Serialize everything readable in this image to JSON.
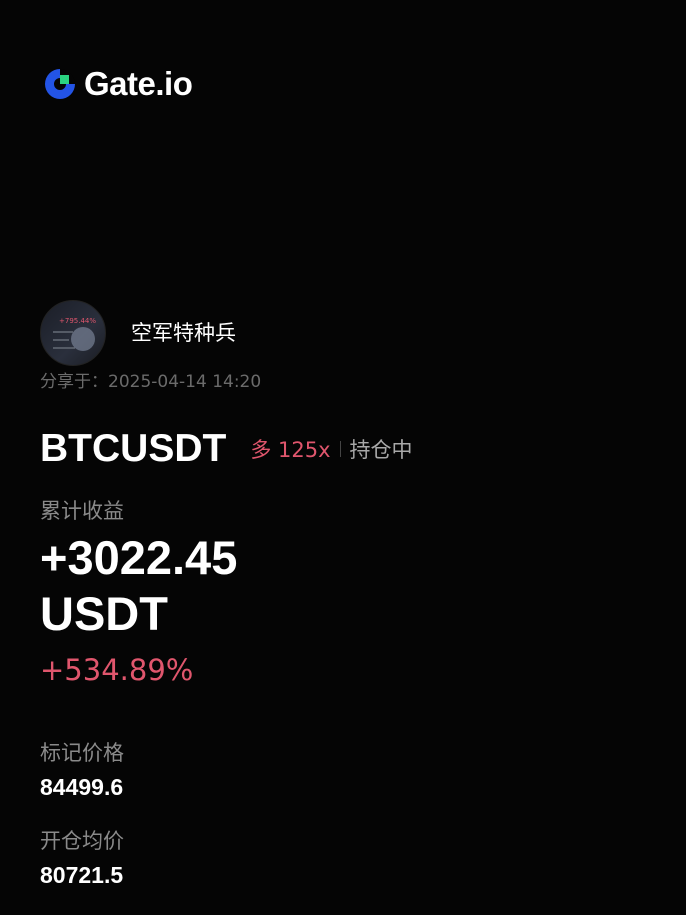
{
  "brand": {
    "name": "Gate.io",
    "accent": "#2354e6",
    "accent2": "#2bd481"
  },
  "user": {
    "name": "空军特种兵",
    "avatar_badge": "+795.44%"
  },
  "shared": {
    "label": "分享于：",
    "datetime": "2025-04-14 14:20"
  },
  "position": {
    "pair": "BTCUSDT",
    "side_leverage": "多 125x",
    "status": "持仓中"
  },
  "pnl": {
    "label": "累计收益",
    "amount": "+3022.45",
    "unit": "USDT",
    "percent": "+534.89%"
  },
  "mark_price": {
    "label": "标记价格",
    "value": "84499.6"
  },
  "entry_price": {
    "label": "开仓均价",
    "value": "80721.5"
  },
  "colors": {
    "positive": "#e0566d",
    "background": "#050505"
  }
}
